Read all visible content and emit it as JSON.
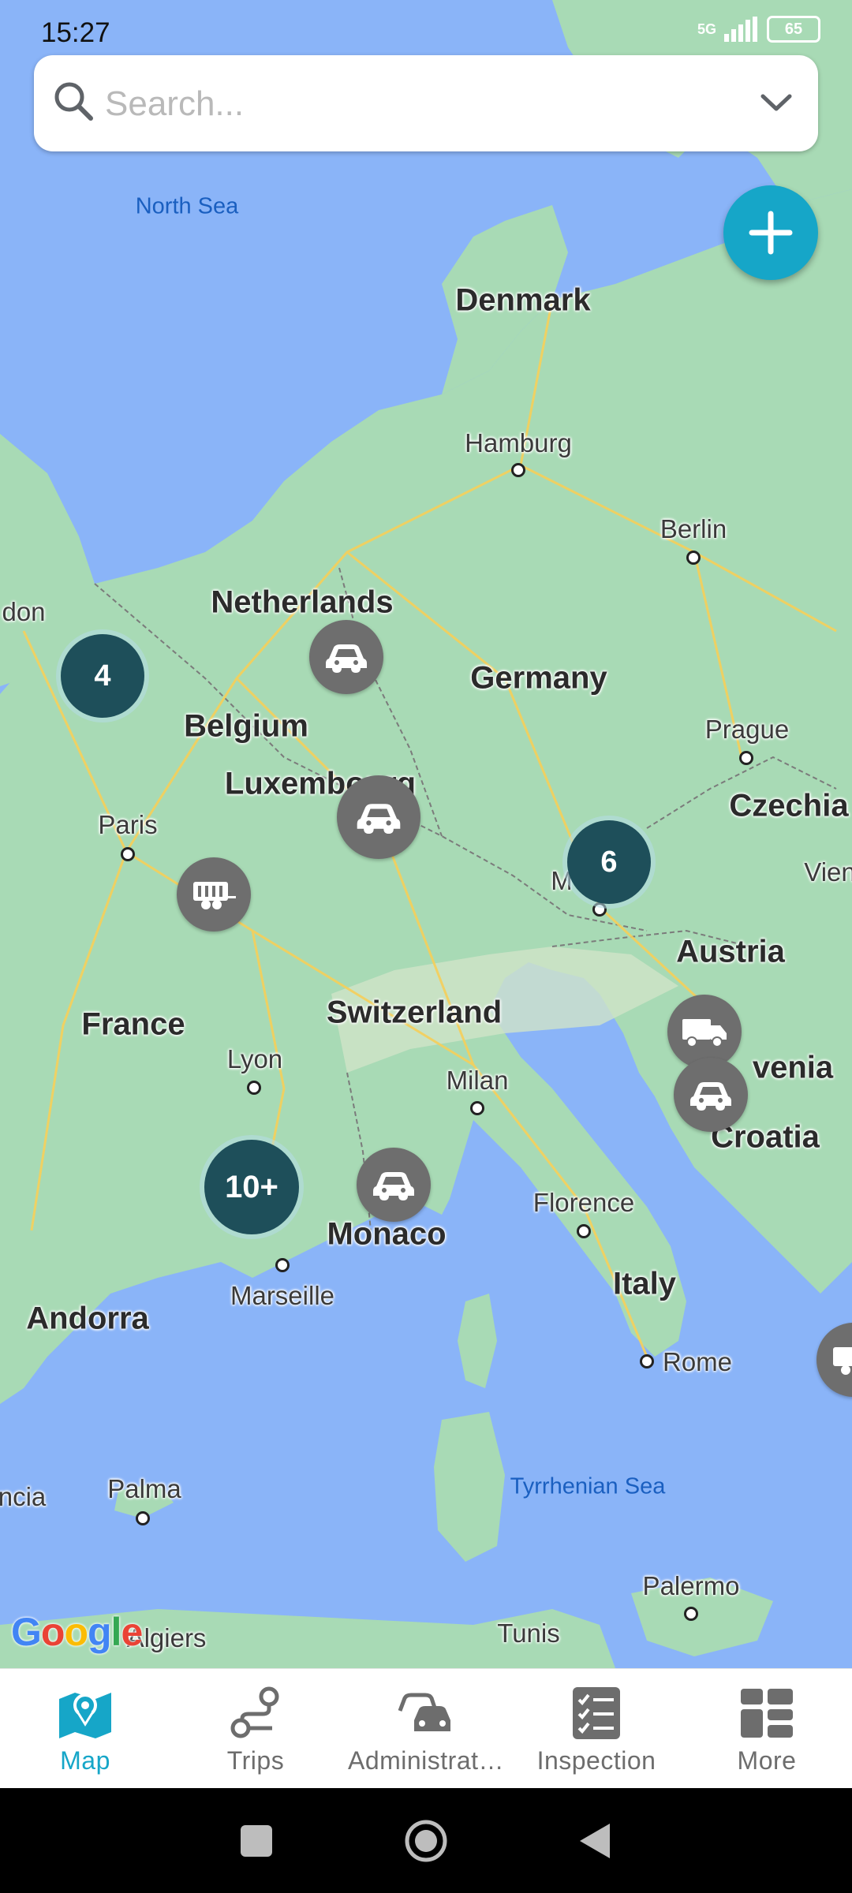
{
  "status_bar": {
    "time": "15:27",
    "network": "5G",
    "battery": "65"
  },
  "search": {
    "placeholder": "Search...",
    "value": ""
  },
  "map": {
    "countries": [
      "Denmark",
      "Netherlands",
      "Germany",
      "Belgium",
      "Luxembourg",
      "Czechia",
      "France",
      "Austria",
      "Switzerland",
      "Croatia",
      "Monaco",
      "Italy",
      "Andorra",
      "venia"
    ],
    "cities": [
      "Hamburg",
      "Berlin",
      "Prague",
      "Paris",
      "Lyon",
      "Milan",
      "Marseille",
      "Florence",
      "Rome",
      "Palma",
      "Palermo",
      "Algiers",
      "Tunis",
      "don",
      "Vien",
      "ncia",
      "M"
    ],
    "seas": [
      "North Sea",
      "Tyrrhenian Sea"
    ],
    "clusters": [
      "4",
      "6",
      "10+"
    ],
    "vehicles": [
      "car",
      "car",
      "trailer",
      "truck",
      "car",
      "car",
      "trailer"
    ],
    "attribution": "Google"
  },
  "bottom_nav": {
    "items": [
      {
        "label": "Map",
        "icon": "map-icon",
        "active": true
      },
      {
        "label": "Trips",
        "icon": "route-icon",
        "active": false
      },
      {
        "label": "Administrat…",
        "icon": "cars-icon",
        "active": false
      },
      {
        "label": "Inspection",
        "icon": "checklist-icon",
        "active": false
      },
      {
        "label": "More",
        "icon": "grid-icon",
        "active": false
      }
    ]
  },
  "colors": {
    "accent": "#16a6c8",
    "cluster": "#1e4f5a",
    "vehicle": "#6e6e6e",
    "water": "#8ab4f8",
    "land": "#a8dab5"
  }
}
